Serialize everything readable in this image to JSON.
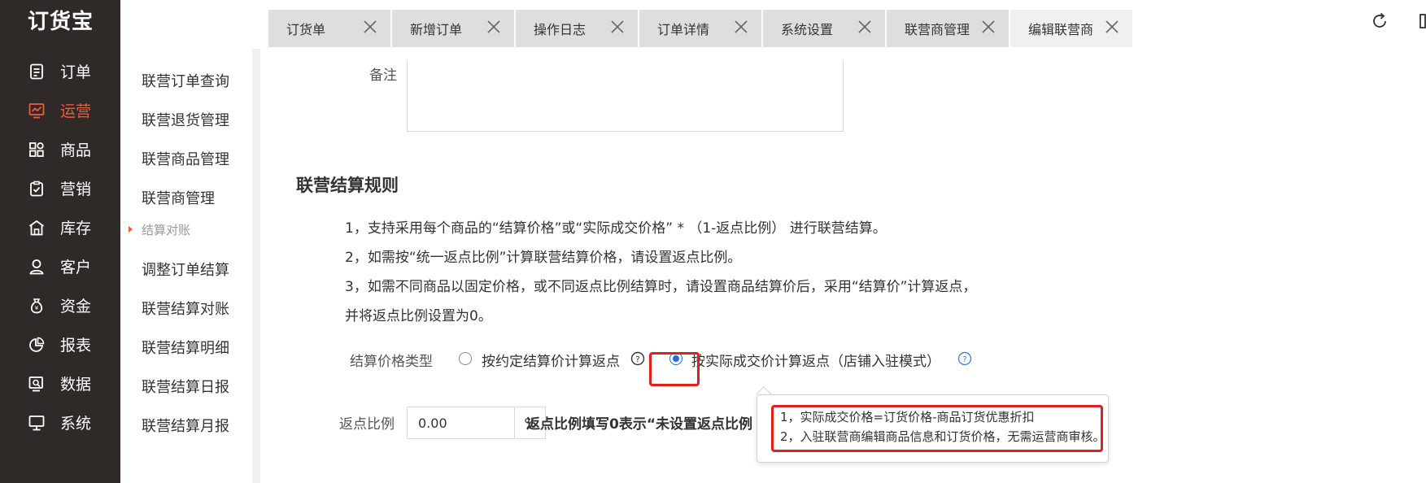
{
  "app": {
    "logo": "订货宝"
  },
  "nav": {
    "items": [
      {
        "label": "订单",
        "icon": "order-icon",
        "active": false
      },
      {
        "label": "运营",
        "icon": "operation-chart-icon",
        "active": true
      },
      {
        "label": "商品",
        "icon": "product-grid-icon",
        "active": false
      },
      {
        "label": "营销",
        "icon": "marketing-icon",
        "active": false
      },
      {
        "label": "库存",
        "icon": "warehouse-icon",
        "active": false
      },
      {
        "label": "客户",
        "icon": "customer-icon",
        "active": false
      },
      {
        "label": "资金",
        "icon": "money-bag-icon",
        "active": false
      },
      {
        "label": "报表",
        "icon": "pie-chart-icon",
        "active": false
      },
      {
        "label": "数据",
        "icon": "data-icon",
        "active": false
      },
      {
        "label": "系统",
        "icon": "monitor-icon",
        "active": false
      }
    ]
  },
  "subnav": {
    "items": [
      {
        "label": "联营订单查询",
        "group": false
      },
      {
        "label": "联营退货管理",
        "group": false
      },
      {
        "label": "联营商品管理",
        "group": false
      },
      {
        "label": "联营商管理",
        "group": false
      },
      {
        "label": "结算对账",
        "group": true
      },
      {
        "label": "调整订单结算",
        "group": false
      },
      {
        "label": "联营结算对账",
        "group": false
      },
      {
        "label": "联营结算明细",
        "group": false
      },
      {
        "label": "联营结算日报",
        "group": false
      },
      {
        "label": "联营结算月报",
        "group": false
      }
    ]
  },
  "tabs": [
    {
      "label": "订货单",
      "active": false
    },
    {
      "label": "新增订单",
      "active": false
    },
    {
      "label": "操作日志",
      "active": false
    },
    {
      "label": "订单详情",
      "active": false
    },
    {
      "label": "系统设置",
      "active": false
    },
    {
      "label": "联营商管理",
      "active": false
    },
    {
      "label": "编辑联营商",
      "active": true
    }
  ],
  "form": {
    "remark_label": "备注",
    "section_title": "联营结算规则",
    "rules": [
      "1，支持采用每个商品的“结算价格”或“实际成交价格” * （1-返点比例） 进行联营结算。",
      "2，如需按“统一返点比例”计算联营结算价格，请设置返点比例。",
      "3，如需不同商品以固定价格，或不同返点比例结算时，请设置商品结算价后，采用“结算价”计算返点，",
      "并将返点比例设置为0。"
    ],
    "price_type_label": "结算价格类型",
    "option_contract": "按约定结算价计算返点",
    "option_actual": "按实际成交价计算返点（店铺入驻模式）",
    "selected_option": "option_actual",
    "rate_label": "返点比例",
    "rate_value": "0.00",
    "rate_unit": "%",
    "rate_hint": "返点比例填写0表示“未设置返点比例"
  },
  "tooltip": {
    "lines": [
      "1，实际成交价格=订货价格-商品订货优惠折扣",
      "2，入驻联营商编辑商品信息和订货价格，无需运营商审核。"
    ]
  },
  "colors": {
    "nav_bg": "#2f2a28",
    "accent": "#f25a3a",
    "radio_checked": "#1e6fd9",
    "highlight_frame": "#e0201c",
    "help_icon": "#4a86d4"
  }
}
